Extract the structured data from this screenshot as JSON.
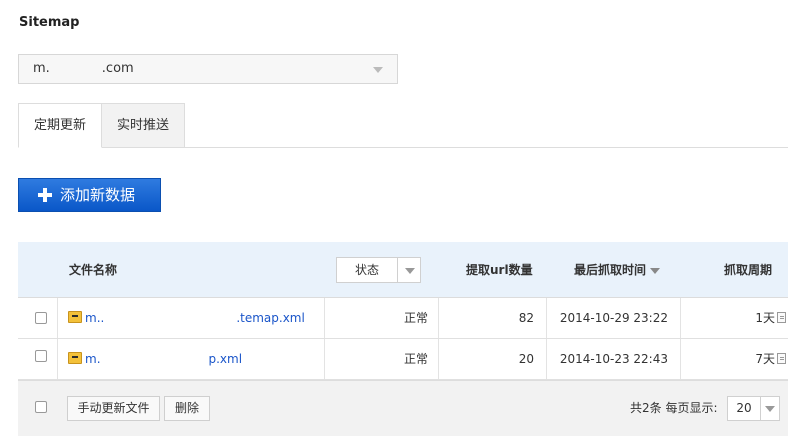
{
  "page": {
    "title": "Sitemap"
  },
  "site_select": {
    "value": "m.    .com"
  },
  "tabs": [
    {
      "label": "定期更新",
      "active": true
    },
    {
      "label": "实时推送",
      "active": false
    }
  ],
  "add_button": {
    "label": "添加新数据"
  },
  "table": {
    "headers": {
      "filename": "文件名称",
      "status_filter": "状态",
      "url_count": "提取url数量",
      "last_crawl": "最后抓取时间",
      "cycle": "抓取周期"
    },
    "rows": [
      {
        "file": "m..           .temap.xml",
        "status": "正常",
        "url_count": "82",
        "last_crawl": "2014-10-29 23:22",
        "cycle": "1天"
      },
      {
        "file": "m.         p.xml",
        "status": "正常",
        "url_count": "20",
        "last_crawl": "2014-10-23 22:43",
        "cycle": "7天"
      }
    ]
  },
  "footer": {
    "manual_update": "手动更新文件",
    "delete": "删除",
    "total": "共2条",
    "per_page_label": "每页显示:",
    "per_page_value": "20"
  },
  "colors": {
    "accent": "#1a62d6",
    "link": "#1a55c9",
    "header_bg": "#e9f2fb"
  }
}
